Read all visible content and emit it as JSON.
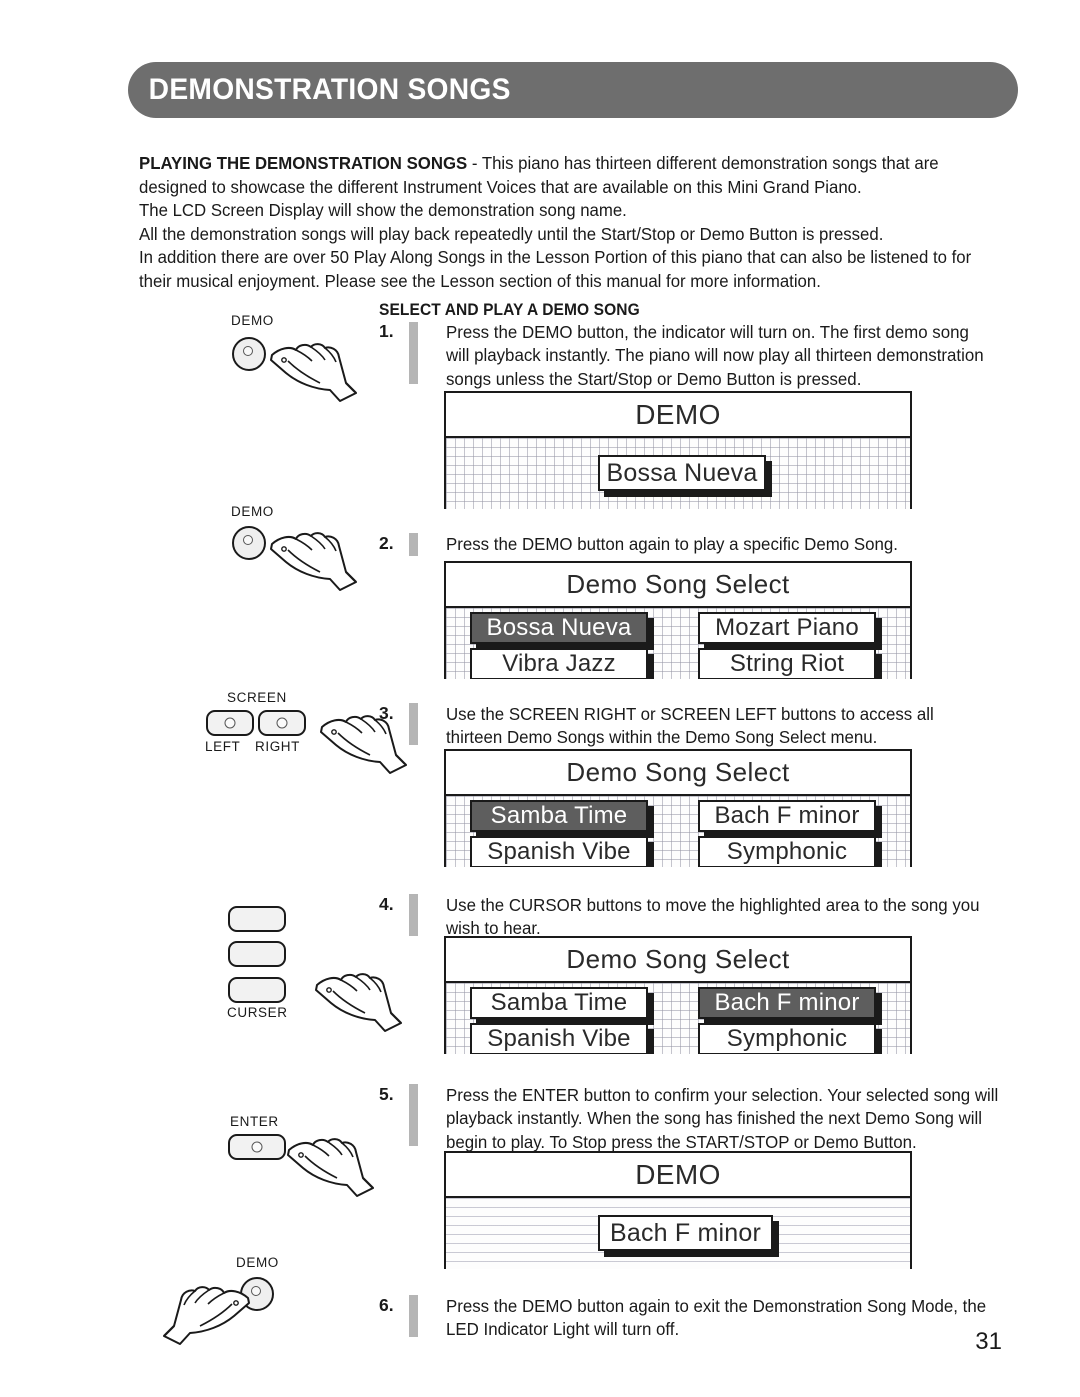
{
  "header": {
    "title": "DEMONSTRATION SONGS"
  },
  "intro": {
    "lead": "PLAYING THE DEMONSTRATION SONGS",
    "lines": [
      " - This piano has thirteen different demonstration songs that are",
      "designed to showcase the different Instrument Voices that are available on this Mini Grand Piano.",
      "The LCD Screen Display will show the demonstration song name.",
      "All the demonstration songs will play back repeatedly until the Start/Stop or Demo Button is pressed.",
      "In addition there are over 50 Play Along Songs in the Lesson Portion of this piano that can also be listened to for",
      "their musical enjoyment.  Please see the Lesson section of this manual for more information."
    ]
  },
  "section_heading": "SELECT AND PLAY A DEMO SONG",
  "steps": [
    {
      "number": "1.",
      "lines": [
        "Press the DEMO button, the indicator will turn on.  The first demo song",
        "will playback instantly.  The piano will now play all thirteen demonstration",
        "songs unless the Start/Stop or Demo Button is pressed."
      ]
    },
    {
      "number": "2.",
      "lines": [
        "Press the DEMO button again to play a specific Demo Song."
      ]
    },
    {
      "number": "3.",
      "lines": [
        "Use the SCREEN RIGHT or SCREEN LEFT buttons to access all",
        "thirteen Demo Songs within the Demo Song Select menu."
      ]
    },
    {
      "number": "4.",
      "lines": [
        "Use the CURSOR buttons to move the highlighted area to the song you",
        "wish to hear."
      ]
    },
    {
      "number": "5.",
      "lines": [
        "Press the ENTER button to confirm your selection.  Your selected song will",
        "playback instantly.  When the song has finished the next Demo Song will",
        "begin to play. To Stop press the START/STOP or Demo Button."
      ]
    },
    {
      "number": "6.",
      "lines": [
        "Press the DEMO button again to exit the Demonstration Song Mode, the",
        "LED Indicator Light will turn off."
      ]
    }
  ],
  "screens": [
    {
      "title": "DEMO",
      "layout": "single",
      "background": "grid",
      "song": "Bossa Nueva"
    },
    {
      "title": "Demo Song Select",
      "layout": "grid",
      "background": "grid",
      "cells": [
        {
          "label": "Bossa Nueva",
          "selected": true
        },
        {
          "label": "Mozart Piano",
          "selected": false
        },
        {
          "label": "Vibra Jazz",
          "selected": false
        },
        {
          "label": "String Riot",
          "selected": false
        }
      ]
    },
    {
      "title": "Demo Song Select",
      "layout": "grid",
      "background": "grid",
      "cells": [
        {
          "label": "Samba Time",
          "selected": true
        },
        {
          "label": "Bach F minor",
          "selected": false
        },
        {
          "label": "Spanish Vibe",
          "selected": false
        },
        {
          "label": "Symphonic",
          "selected": false
        }
      ]
    },
    {
      "title": "Demo Song Select",
      "layout": "grid",
      "background": "grid",
      "cells": [
        {
          "label": "Samba Time",
          "selected": false
        },
        {
          "label": "Bach F minor",
          "selected": true
        },
        {
          "label": "Spanish Vibe",
          "selected": false
        },
        {
          "label": "Symphonic",
          "selected": false
        }
      ]
    },
    {
      "title": "DEMO",
      "layout": "single",
      "background": "lines",
      "song": "Bach F minor"
    }
  ],
  "panel_buttons": {
    "demo_1": {
      "label": "DEMO"
    },
    "demo_2": {
      "label": "DEMO"
    },
    "screen": {
      "group_label": "SCREEN",
      "left_label": "LEFT",
      "right_label": "RIGHT"
    },
    "curser": {
      "group_label": "CURSER"
    },
    "enter": {
      "label": "ENTER"
    },
    "demo_3": {
      "label": "DEMO"
    }
  },
  "page_number": "31",
  "colors": {
    "banner": "#6e6e6e",
    "selected_cell": "#5e5e5e",
    "step_bar": "#b5b5b5",
    "outline": "#1a1a1a"
  }
}
